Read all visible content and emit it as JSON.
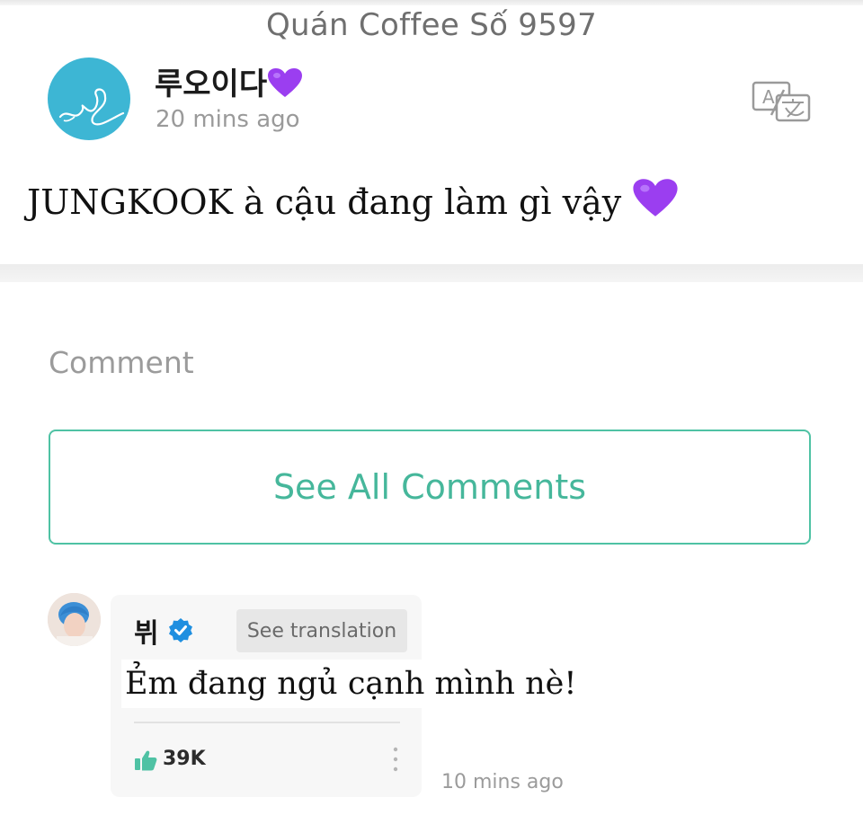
{
  "watermark": "Quán Coffee Số 9597",
  "post": {
    "author_name": "루오이다",
    "author_emoji_icon": "purple-heart-icon",
    "time_ago": "20 mins ago",
    "translate_icon": "translate-icon",
    "body_text": "JUNGKOOK à cậu đang làm gì vậy",
    "body_emoji_icon": "purple-heart-icon"
  },
  "comments_section": {
    "heading": "Comment",
    "see_all_label": "See All Comments",
    "comment": {
      "author": "뷔",
      "verified_icon": "verified-badge-icon",
      "see_translation_label": "See translation",
      "text": "Ẻm đang ngủ cạnh mình nè!",
      "like_icon": "thumbs-up-icon",
      "likes": "39K",
      "more_icon": "more-vertical-icon",
      "time_ago": "10 mins ago"
    }
  },
  "colors": {
    "accent": "#4fc2a4",
    "heart": "#9b3ef0",
    "avatar_bg": "#3db6d4",
    "verified": "#1f8fe0"
  }
}
